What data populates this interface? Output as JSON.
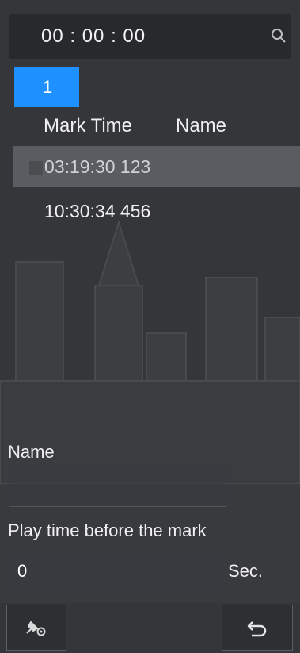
{
  "search": {
    "time_value": "00 :  00 :  00"
  },
  "list": {
    "page_number": "1",
    "columns": [
      "Mark Time",
      "Name"
    ],
    "rows": [
      {
        "time": "03:19:30 123",
        "name": "",
        "selected": true
      },
      {
        "time": "10:30:34 456",
        "name": ""
      }
    ]
  },
  "form": {
    "name_label": "Name",
    "name_value": "",
    "play_label": "Play time before the mark",
    "play_value": "0",
    "play_unit": "Sec."
  },
  "toolbar": {
    "left_icon": "mark-settings-icon",
    "right_icon": "back-icon"
  },
  "colors": {
    "accent": "#1e90ff",
    "background": "#2e3033"
  }
}
